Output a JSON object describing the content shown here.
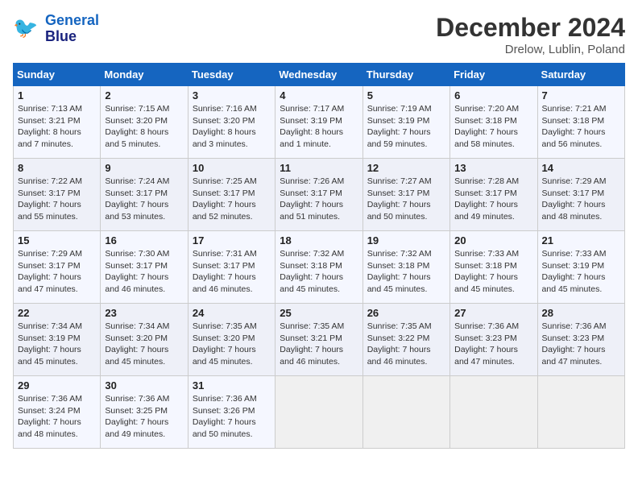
{
  "header": {
    "logo_line1": "General",
    "logo_line2": "Blue",
    "month": "December 2024",
    "location": "Drelow, Lublin, Poland"
  },
  "days_of_week": [
    "Sunday",
    "Monday",
    "Tuesday",
    "Wednesday",
    "Thursday",
    "Friday",
    "Saturday"
  ],
  "weeks": [
    [
      {
        "day": "1",
        "info": "Sunrise: 7:13 AM\nSunset: 3:21 PM\nDaylight: 8 hours\nand 7 minutes."
      },
      {
        "day": "2",
        "info": "Sunrise: 7:15 AM\nSunset: 3:20 PM\nDaylight: 8 hours\nand 5 minutes."
      },
      {
        "day": "3",
        "info": "Sunrise: 7:16 AM\nSunset: 3:20 PM\nDaylight: 8 hours\nand 3 minutes."
      },
      {
        "day": "4",
        "info": "Sunrise: 7:17 AM\nSunset: 3:19 PM\nDaylight: 8 hours\nand 1 minute."
      },
      {
        "day": "5",
        "info": "Sunrise: 7:19 AM\nSunset: 3:19 PM\nDaylight: 7 hours\nand 59 minutes."
      },
      {
        "day": "6",
        "info": "Sunrise: 7:20 AM\nSunset: 3:18 PM\nDaylight: 7 hours\nand 58 minutes."
      },
      {
        "day": "7",
        "info": "Sunrise: 7:21 AM\nSunset: 3:18 PM\nDaylight: 7 hours\nand 56 minutes."
      }
    ],
    [
      {
        "day": "8",
        "info": "Sunrise: 7:22 AM\nSunset: 3:17 PM\nDaylight: 7 hours\nand 55 minutes."
      },
      {
        "day": "9",
        "info": "Sunrise: 7:24 AM\nSunset: 3:17 PM\nDaylight: 7 hours\nand 53 minutes."
      },
      {
        "day": "10",
        "info": "Sunrise: 7:25 AM\nSunset: 3:17 PM\nDaylight: 7 hours\nand 52 minutes."
      },
      {
        "day": "11",
        "info": "Sunrise: 7:26 AM\nSunset: 3:17 PM\nDaylight: 7 hours\nand 51 minutes."
      },
      {
        "day": "12",
        "info": "Sunrise: 7:27 AM\nSunset: 3:17 PM\nDaylight: 7 hours\nand 50 minutes."
      },
      {
        "day": "13",
        "info": "Sunrise: 7:28 AM\nSunset: 3:17 PM\nDaylight: 7 hours\nand 49 minutes."
      },
      {
        "day": "14",
        "info": "Sunrise: 7:29 AM\nSunset: 3:17 PM\nDaylight: 7 hours\nand 48 minutes."
      }
    ],
    [
      {
        "day": "15",
        "info": "Sunrise: 7:29 AM\nSunset: 3:17 PM\nDaylight: 7 hours\nand 47 minutes."
      },
      {
        "day": "16",
        "info": "Sunrise: 7:30 AM\nSunset: 3:17 PM\nDaylight: 7 hours\nand 46 minutes."
      },
      {
        "day": "17",
        "info": "Sunrise: 7:31 AM\nSunset: 3:17 PM\nDaylight: 7 hours\nand 46 minutes."
      },
      {
        "day": "18",
        "info": "Sunrise: 7:32 AM\nSunset: 3:18 PM\nDaylight: 7 hours\nand 45 minutes."
      },
      {
        "day": "19",
        "info": "Sunrise: 7:32 AM\nSunset: 3:18 PM\nDaylight: 7 hours\nand 45 minutes."
      },
      {
        "day": "20",
        "info": "Sunrise: 7:33 AM\nSunset: 3:18 PM\nDaylight: 7 hours\nand 45 minutes."
      },
      {
        "day": "21",
        "info": "Sunrise: 7:33 AM\nSunset: 3:19 PM\nDaylight: 7 hours\nand 45 minutes."
      }
    ],
    [
      {
        "day": "22",
        "info": "Sunrise: 7:34 AM\nSunset: 3:19 PM\nDaylight: 7 hours\nand 45 minutes."
      },
      {
        "day": "23",
        "info": "Sunrise: 7:34 AM\nSunset: 3:20 PM\nDaylight: 7 hours\nand 45 minutes."
      },
      {
        "day": "24",
        "info": "Sunrise: 7:35 AM\nSunset: 3:20 PM\nDaylight: 7 hours\nand 45 minutes."
      },
      {
        "day": "25",
        "info": "Sunrise: 7:35 AM\nSunset: 3:21 PM\nDaylight: 7 hours\nand 46 minutes."
      },
      {
        "day": "26",
        "info": "Sunrise: 7:35 AM\nSunset: 3:22 PM\nDaylight: 7 hours\nand 46 minutes."
      },
      {
        "day": "27",
        "info": "Sunrise: 7:36 AM\nSunset: 3:23 PM\nDaylight: 7 hours\nand 47 minutes."
      },
      {
        "day": "28",
        "info": "Sunrise: 7:36 AM\nSunset: 3:23 PM\nDaylight: 7 hours\nand 47 minutes."
      }
    ],
    [
      {
        "day": "29",
        "info": "Sunrise: 7:36 AM\nSunset: 3:24 PM\nDaylight: 7 hours\nand 48 minutes."
      },
      {
        "day": "30",
        "info": "Sunrise: 7:36 AM\nSunset: 3:25 PM\nDaylight: 7 hours\nand 49 minutes."
      },
      {
        "day": "31",
        "info": "Sunrise: 7:36 AM\nSunset: 3:26 PM\nDaylight: 7 hours\nand 50 minutes."
      },
      {
        "day": "",
        "info": ""
      },
      {
        "day": "",
        "info": ""
      },
      {
        "day": "",
        "info": ""
      },
      {
        "day": "",
        "info": ""
      }
    ]
  ]
}
